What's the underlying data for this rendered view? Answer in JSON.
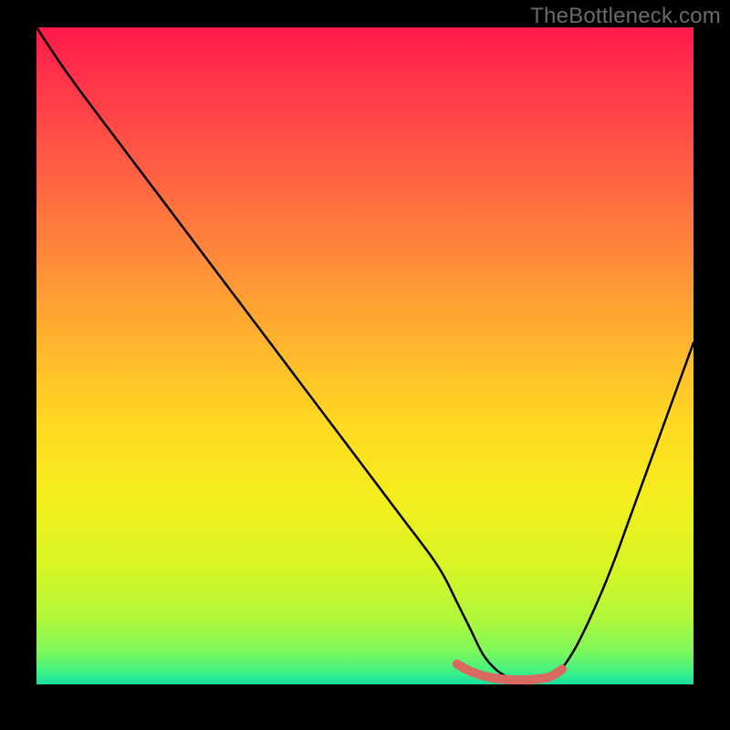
{
  "watermark": "TheBottleneck.com",
  "chart_data": {
    "type": "line",
    "title": "",
    "xlabel": "",
    "ylabel": "",
    "xlim": [
      0,
      100
    ],
    "ylim": [
      0,
      100
    ],
    "series": [
      {
        "name": "curve",
        "x": [
          0,
          4,
          8,
          12,
          16,
          20,
          24,
          28,
          32,
          36,
          40,
          44,
          48,
          52,
          56,
          60,
          62,
          64,
          66,
          68,
          70,
          72,
          74,
          76,
          78,
          80,
          82,
          84,
          86,
          88,
          90,
          92,
          94,
          96,
          98,
          100
        ],
        "y": [
          100,
          94,
          88.5,
          83.2,
          77.9,
          72.6,
          67.3,
          62,
          56.7,
          51.4,
          46.1,
          40.8,
          35.5,
          30.2,
          24.9,
          19.6,
          16.5,
          12.5,
          8.5,
          4.5,
          2.2,
          1,
          0.5,
          0.5,
          1,
          2.5,
          5.5,
          9.5,
          14,
          19,
          24.5,
          30,
          35.5,
          41,
          46.5,
          52
        ]
      },
      {
        "name": "highlight",
        "x": [
          64,
          66,
          68,
          70,
          71,
          72,
          73,
          74,
          75,
          76,
          77,
          78,
          79,
          80
        ],
        "y": [
          3.1,
          2.0,
          1.3,
          0.9,
          0.8,
          0.7,
          0.7,
          0.7,
          0.7,
          0.8,
          0.9,
          1.1,
          1.6,
          2.3
        ]
      }
    ],
    "gradient_stops": [
      {
        "offset": 0.0,
        "color": "#ff1a4b"
      },
      {
        "offset": 0.1,
        "color": "#ff3a49"
      },
      {
        "offset": 0.22,
        "color": "#ff6044"
      },
      {
        "offset": 0.35,
        "color": "#ff8a3a"
      },
      {
        "offset": 0.48,
        "color": "#ffb42e"
      },
      {
        "offset": 0.6,
        "color": "#ffd822"
      },
      {
        "offset": 0.72,
        "color": "#f4ef1e"
      },
      {
        "offset": 0.82,
        "color": "#d8f526"
      },
      {
        "offset": 0.9,
        "color": "#b1f73c"
      },
      {
        "offset": 0.95,
        "color": "#7ef85a"
      },
      {
        "offset": 0.985,
        "color": "#36f08a"
      },
      {
        "offset": 1.0,
        "color": "#18dca2"
      }
    ],
    "highlight_color": "#d86a62",
    "curve_color": "#000000",
    "annotations": []
  }
}
